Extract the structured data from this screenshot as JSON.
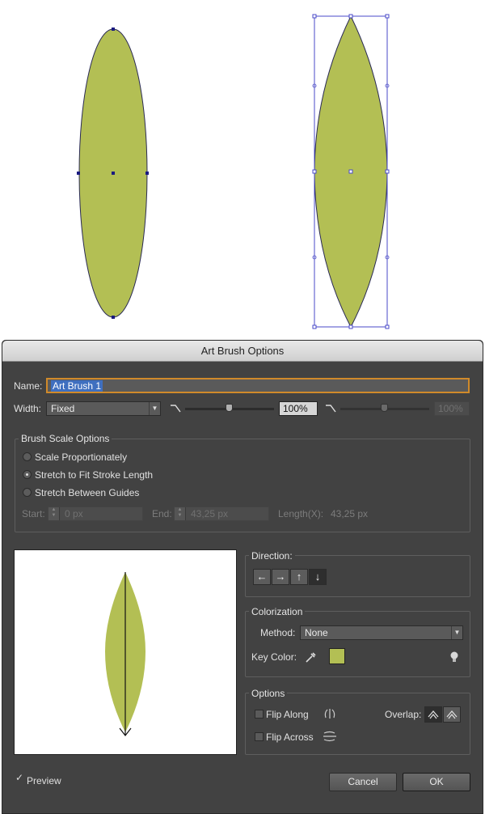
{
  "dialog": {
    "title": "Art Brush Options"
  },
  "name": {
    "label": "Name:",
    "value": "Art Brush 1"
  },
  "width": {
    "label": "Width:",
    "mode": "Fixed",
    "value1": "100%",
    "value2": "100%"
  },
  "brush_scale": {
    "title": "Brush Scale Options",
    "options": [
      "Scale Proportionately",
      "Stretch to Fit Stroke Length",
      "Stretch Between Guides"
    ],
    "selected": 1,
    "start_label": "Start:",
    "start_value": "0 px",
    "end_label": "End:",
    "end_value": "43,25 px",
    "length_label": "Length(X):",
    "length_value": "43,25 px"
  },
  "direction": {
    "title": "Direction:",
    "buttons": [
      "←",
      "→",
      "↑",
      "↓"
    ],
    "selected": 3
  },
  "colorization": {
    "title": "Colorization",
    "method_label": "Method:",
    "method_value": "None",
    "key_color_label": "Key Color:",
    "key_color": "#b3bf54"
  },
  "options": {
    "title": "Options",
    "flip_along": "Flip Along",
    "flip_across": "Flip Across",
    "overlap_label": "Overlap:"
  },
  "footer": {
    "preview_label": "Preview",
    "preview_checked": true,
    "cancel": "Cancel",
    "ok": "OK"
  },
  "colors": {
    "leaf": "#b3bf54",
    "dialog_bg": "#424242",
    "bbox": "#4a4ac8"
  }
}
